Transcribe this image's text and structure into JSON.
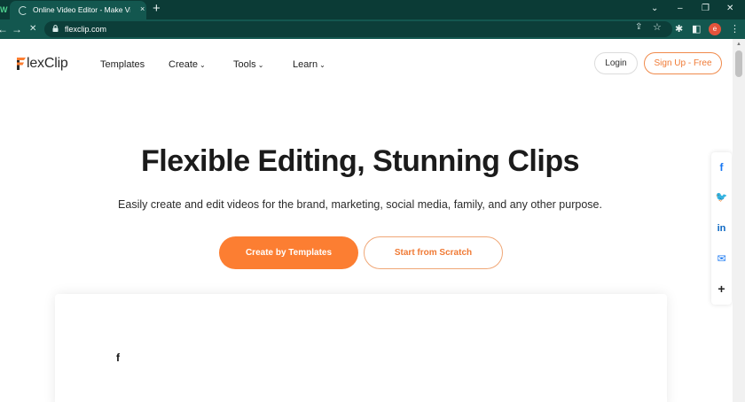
{
  "browser": {
    "tab_edge_glyph": "W",
    "tab_title": "Online Video Editor - Make Video",
    "tab_close": "×",
    "new_tab": "+",
    "window_controls": {
      "chevron": "⌄",
      "minimize": "–",
      "restore": "❐",
      "close": "✕"
    },
    "nav": {
      "back": "←",
      "forward": "→",
      "stop": "✕"
    },
    "url": "flexclip.com",
    "omnibox_icons": {
      "share": "⇪",
      "star": "☆"
    },
    "extensions": {
      "puzzle": "✱",
      "sidebar": "◧",
      "menu": "⋮"
    },
    "profile_initial": "e"
  },
  "header": {
    "logo_text": "lexClip",
    "nav": [
      {
        "label": "Templates",
        "chevron": ""
      },
      {
        "label": "Create",
        "chevron": "⌄"
      },
      {
        "label": "Tools",
        "chevron": "⌄"
      },
      {
        "label": "Learn",
        "chevron": "⌄"
      }
    ],
    "login_label": "Login",
    "signup_label": "Sign Up - Free"
  },
  "hero": {
    "title": "Flexible Editing, Stunning Clips",
    "subtitle": "Easily create and edit videos for the brand, marketing, social media, family, and any other purpose.",
    "primary_cta": "Create by Templates",
    "secondary_cta": "Start from Scratch"
  },
  "preview": {
    "glyph": "f"
  },
  "share": {
    "facebook": "f",
    "twitter": "🐦",
    "linkedin": "in",
    "email": "✉",
    "more": "+"
  },
  "colors": {
    "chrome_dark": "#0b3b36",
    "chrome_toolbar": "#13574f",
    "brand_orange": "#fc7e32",
    "facebook_blue": "#1877f2",
    "twitter_blue": "#1d9bf0",
    "linkedin_blue": "#0a66c2"
  }
}
